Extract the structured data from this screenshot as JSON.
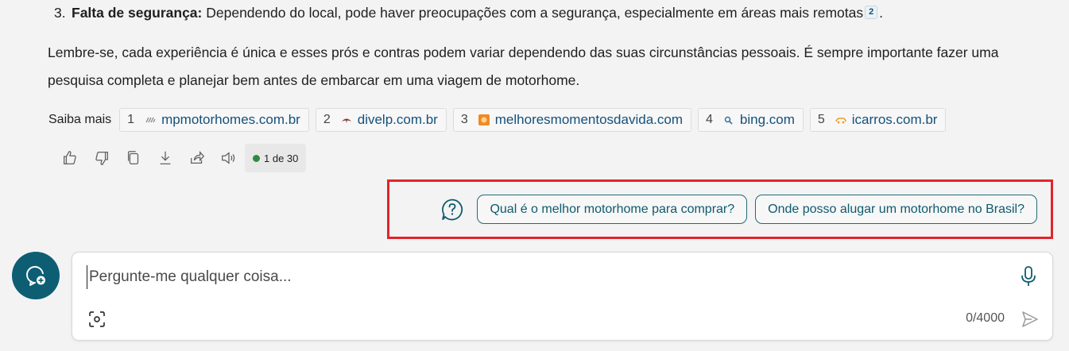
{
  "answer": {
    "list_item": {
      "number": "3.",
      "bold": "Falta de segurança:",
      "text": " Dependendo do local, pode haver preocupações com a segurança, especialmente em áreas mais remotas",
      "citation": "2",
      "end": "."
    },
    "paragraph": "Lembre-se, cada experiência é única e esses prós e contras podem variar dependendo das suas circunstâncias pessoais. É sempre importante fazer uma pesquisa completa e planejar bem antes de embarcar em uma viagem de motorhome."
  },
  "learn_more": {
    "label": "Saiba mais",
    "sources": [
      {
        "n": "1",
        "domain": "mpmotorhomes.com.br",
        "icon": "mp-logo-icon",
        "color": "#888888"
      },
      {
        "n": "2",
        "domain": "divelp.com.br",
        "icon": "divelp-logo-icon",
        "color": "#a32a2a"
      },
      {
        "n": "3",
        "domain": "melhoresmomentosdavida.com",
        "icon": "melhores-logo-icon",
        "color": "#f08a24"
      },
      {
        "n": "4",
        "domain": "bing.com",
        "icon": "search-icon",
        "color": "#3a6ea5"
      },
      {
        "n": "5",
        "domain": "icarros.com.br",
        "icon": "icarros-logo-icon",
        "color": "#f29a2e"
      }
    ]
  },
  "actions": {
    "icons": [
      "thumbs-up-icon",
      "thumbs-down-icon",
      "copy-icon",
      "download-icon",
      "share-icon",
      "speaker-icon"
    ],
    "counter": "1 de 30",
    "counter_color": "#2e8b3e"
  },
  "suggestions": {
    "icon": "question-bubble-icon",
    "items": [
      "Qual é o melhor motorhome para comprar?",
      "Onde posso alugar um motorhome no Brasil?"
    ],
    "highlight_color": "#e3242b"
  },
  "composer": {
    "placeholder": "Pergunte-me qualquer coisa...",
    "char_count": "0/4000",
    "accent": "#0d5e73"
  }
}
